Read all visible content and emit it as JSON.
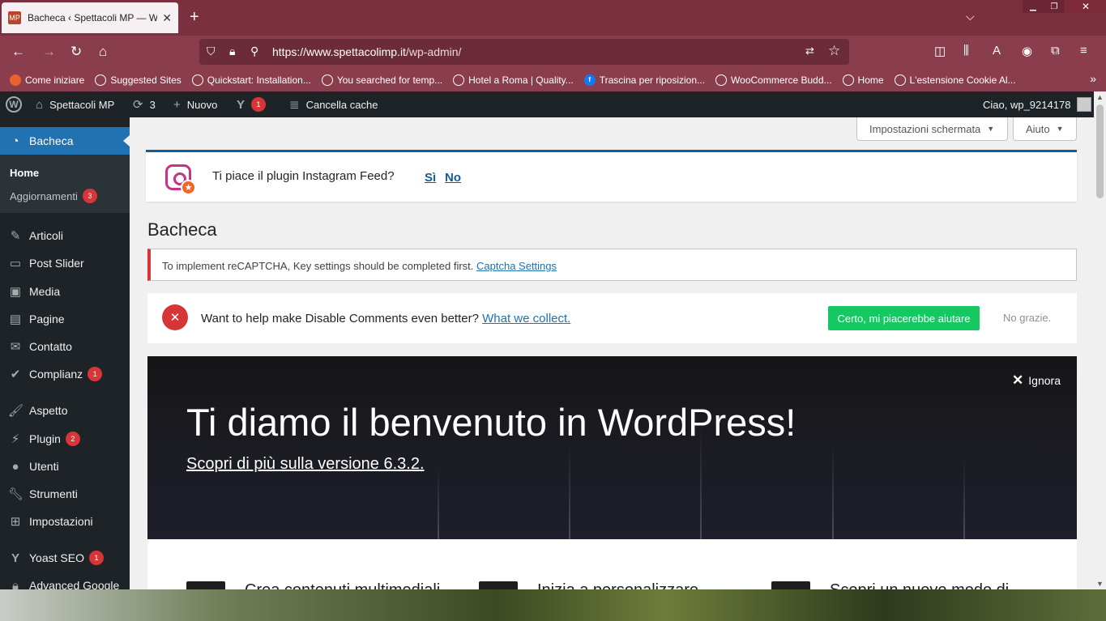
{
  "browser": {
    "tab_title": "Bacheca ‹ Spettacoli MP — Wor",
    "tab_close": "✕",
    "new_tab": "+",
    "url_domain": "https://www.spettacolimp.it",
    "url_path": "/wp-admin/",
    "window_controls": {
      "minimize": "▁",
      "restore": "❐",
      "close": "✕"
    }
  },
  "bookmarks": [
    {
      "label": "Come iniziare",
      "icon": "firefox-icon"
    },
    {
      "label": "Suggested Sites",
      "icon": "globe-icon"
    },
    {
      "label": "Quickstart: Installation...",
      "icon": "globe-icon"
    },
    {
      "label": "You searched for temp...",
      "icon": "globe-icon"
    },
    {
      "label": "Hotel a Roma | Quality...",
      "icon": "globe-icon"
    },
    {
      "label": "Trascina per riposizion...",
      "icon": "facebook-icon"
    },
    {
      "label": "WooCommerce Budd...",
      "icon": "globe-icon"
    },
    {
      "label": "Home",
      "icon": "globe-icon"
    },
    {
      "label": "L'estensione Cookie Al...",
      "icon": "globe-icon"
    }
  ],
  "adminbar": {
    "site_name": "Spettacoli MP",
    "updates_count": "3",
    "new_label": "Nuovo",
    "yoast_count": "1",
    "clear_cache": "Cancella cache",
    "greeting": "Ciao, wp_9214178"
  },
  "sidebar": {
    "current": "Bacheca",
    "sub_home": "Home",
    "sub_updates": "Aggiornamenti",
    "sub_updates_count": "3",
    "items": [
      {
        "label": "Articoli",
        "icon": "pin-icon"
      },
      {
        "label": "Post Slider",
        "icon": "slider-icon"
      },
      {
        "label": "Media",
        "icon": "media-icon"
      },
      {
        "label": "Pagine",
        "icon": "page-icon"
      },
      {
        "label": "Contatto",
        "icon": "mail-icon"
      },
      {
        "label": "Complianz",
        "icon": "check-icon",
        "badge": "1"
      },
      {
        "label": "Aspetto",
        "icon": "brush-icon"
      },
      {
        "label": "Plugin",
        "icon": "plugin-icon",
        "badge": "2"
      },
      {
        "label": "Utenti",
        "icon": "user-icon"
      },
      {
        "label": "Strumenti",
        "icon": "wrench-icon"
      },
      {
        "label": "Impostazioni",
        "icon": "settings-icon"
      },
      {
        "label": "Yoast SEO",
        "icon": "yoast-icon",
        "badge": "1"
      },
      {
        "label": "Advanced Google",
        "icon": "lock-icon"
      }
    ]
  },
  "content": {
    "screen_options": "Impostazioni schermata",
    "help": "Aiuto",
    "instagram": {
      "question": "Ti piace il plugin Instagram Feed?",
      "yes": "Sì",
      "no": "No"
    },
    "page_title": "Bacheca",
    "recaptcha": {
      "text": "To implement reCAPTCHA, Key settings should be completed first.",
      "link": "Captcha Settings"
    },
    "disable_comments": {
      "text": "Want to help make Disable Comments even better?",
      "link": "What we collect.",
      "accept": "Certo, mi piacerebbe aiutare",
      "decline": "No grazie."
    },
    "welcome": {
      "dismiss": "Ignora",
      "title": "Ti diamo il benvenuto in WordPress!",
      "link": "Scopri di più sulla versione 6.3.2."
    },
    "columns": [
      "Crea contenuti multimediali",
      "Inizia a personalizzare",
      "Scopri un nuovo modo di"
    ]
  }
}
